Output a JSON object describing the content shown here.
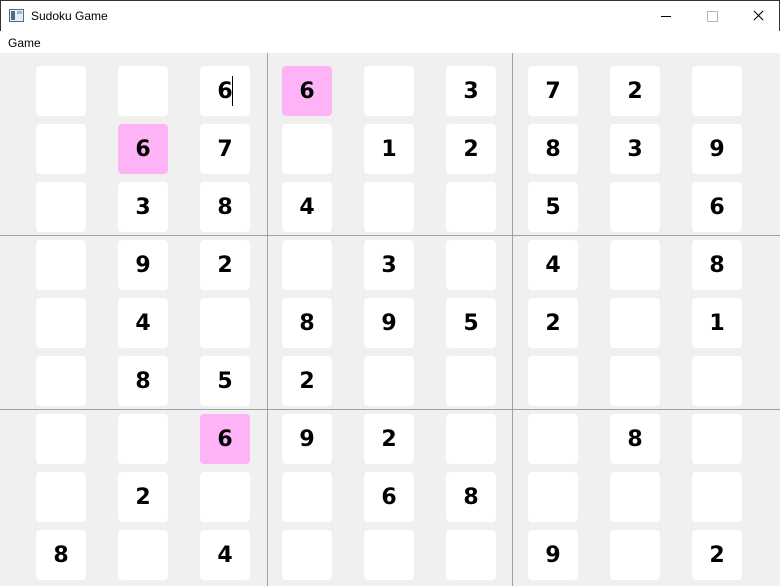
{
  "window": {
    "title": "Sudoku Game",
    "icon": "app-window-icon"
  },
  "menu": {
    "items": [
      "Game"
    ]
  },
  "colors": {
    "board_background": "#f0f0f0",
    "cell_background": "#ffffff",
    "highlight": "#ffb3f7",
    "block_divider": "#a0a0a0"
  },
  "grid": {
    "rows": [
      [
        "",
        "",
        "6",
        "6",
        "",
        "3",
        "7",
        "2",
        ""
      ],
      [
        "",
        "6",
        "7",
        "",
        "1",
        "2",
        "8",
        "3",
        "9"
      ],
      [
        "",
        "3",
        "8",
        "4",
        "",
        "",
        "5",
        "",
        "6"
      ],
      [
        "",
        "9",
        "2",
        "",
        "3",
        "",
        "4",
        "",
        "8"
      ],
      [
        "",
        "4",
        "",
        "8",
        "9",
        "5",
        "2",
        "",
        "1"
      ],
      [
        "",
        "8",
        "5",
        "2",
        "",
        "",
        "",
        "",
        ""
      ],
      [
        "",
        "",
        "6",
        "9",
        "2",
        "",
        "",
        "8",
        ""
      ],
      [
        "",
        "2",
        "",
        "",
        "6",
        "8",
        "",
        "",
        ""
      ],
      [
        "8",
        "",
        "4",
        "",
        "",
        "",
        "9",
        "",
        "2"
      ]
    ],
    "highlighted_cells": [
      [
        0,
        3
      ],
      [
        1,
        1
      ],
      [
        6,
        2
      ]
    ],
    "active_cell": [
      0,
      2
    ]
  }
}
